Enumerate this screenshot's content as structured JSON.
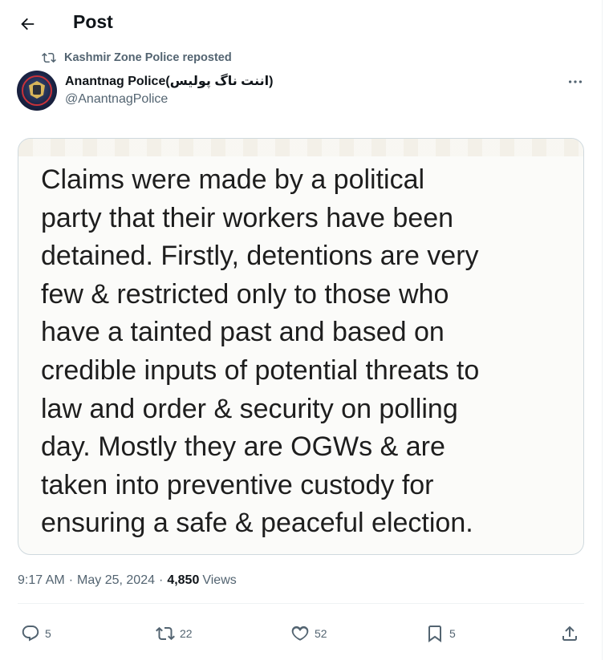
{
  "header": {
    "title": "Post"
  },
  "repost": {
    "text": "Kashmir Zone Police reposted"
  },
  "author": {
    "display_name": "Anantnag Police(اننت ناگ پولیس)",
    "handle": "@AnantnagPolice"
  },
  "media": {
    "text": "Claims were  made by a  political\nparty that their workers have been\ndetained. Firstly, detentions are very\nfew &  restricted only to those who\nhave a tainted past and based on\ncredible inputs of  potential threats to\nlaw and order & security on polling\nday. Mostly they are  OGWs  & are\ntaken into preventive custody for\nensuring a safe &  peaceful election."
  },
  "meta": {
    "time": "9:17 AM",
    "date": "May 25, 2024",
    "views_count": "4,850",
    "views_label": "Views",
    "separator": "·"
  },
  "actions": {
    "replies": "5",
    "reposts": "22",
    "likes": "52",
    "bookmarks": "5"
  },
  "icons": {
    "back": "arrow-left-icon",
    "repost": "repost-icon",
    "more": "more-horizontal-icon",
    "reply": "reply-icon",
    "like": "heart-icon",
    "bookmark": "bookmark-icon",
    "share": "share-icon"
  },
  "colors": {
    "text_primary": "#0f1419",
    "text_secondary": "#536471",
    "border": "#cfd9de"
  }
}
